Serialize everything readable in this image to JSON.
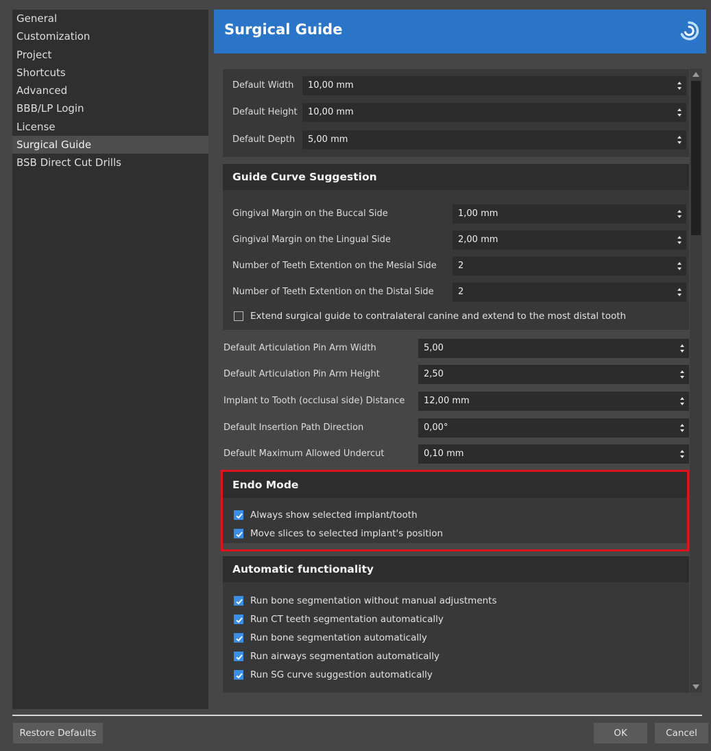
{
  "sidebar": {
    "items": [
      {
        "label": "General"
      },
      {
        "label": "Customization"
      },
      {
        "label": "Project"
      },
      {
        "label": "Shortcuts"
      },
      {
        "label": "Advanced"
      },
      {
        "label": "BBB/LP Login"
      },
      {
        "label": "License"
      },
      {
        "label": "Surgical Guide",
        "active": true
      },
      {
        "label": "BSB Direct Cut Drills"
      }
    ]
  },
  "header": {
    "title": "Surgical Guide",
    "logo_icon": "swirl-logo-icon"
  },
  "defaults": {
    "width": {
      "label": "Default Width",
      "value": "10,00 mm"
    },
    "height": {
      "label": "Default Height",
      "value": "10,00 mm"
    },
    "depth": {
      "label": "Default Depth",
      "value": "5,00 mm"
    }
  },
  "guide_curve": {
    "title": "Guide Curve Suggestion",
    "buccal": {
      "label": "Gingival Margin on the Buccal Side",
      "value": "1,00 mm"
    },
    "lingual": {
      "label": "Gingival Margin on the Lingual Side",
      "value": "2,00 mm"
    },
    "mesial": {
      "label": "Number of Teeth Extention on the Mesial Side",
      "value": "2"
    },
    "distal": {
      "label": "Number of Teeth Extention on the Distal Side",
      "value": "2"
    },
    "extend": {
      "label": "Extend surgical guide to contralateral canine and extend to the most distal tooth",
      "checked": false
    }
  },
  "articulation": {
    "pin_width": {
      "label": "Default Articulation Pin Arm Width",
      "value": "5,00"
    },
    "pin_height": {
      "label": "Default Articulation Pin Arm Height",
      "value": "2,50"
    },
    "implant_distance": {
      "label": "Implant to Tooth (occlusal side) Distance",
      "value": "12,00 mm"
    },
    "insertion_path": {
      "label": "Default Insertion Path Direction",
      "value": "0,00°"
    },
    "undercut": {
      "label": "Default Maximum Allowed Undercut",
      "value": "0,10 mm"
    }
  },
  "endo_mode": {
    "title": "Endo Mode",
    "show_selected": {
      "label": "Always show selected implant/tooth",
      "checked": true
    },
    "move_slices": {
      "label": "Move slices to selected implant's position",
      "checked": true
    }
  },
  "automatic": {
    "title": "Automatic functionality",
    "items": [
      {
        "label": "Run bone segmentation without manual adjustments",
        "checked": true
      },
      {
        "label": "Run CT teeth segmentation automatically",
        "checked": true
      },
      {
        "label": "Run bone segmentation automatically",
        "checked": true
      },
      {
        "label": "Run airways segmentation automatically",
        "checked": true
      },
      {
        "label": "Run SG curve suggestion automatically",
        "checked": true
      }
    ]
  },
  "footer": {
    "restore_label": "Restore Defaults",
    "ok_label": "OK",
    "cancel_label": "Cancel"
  },
  "colors": {
    "header_blue": "#2a75c8",
    "checkbox_blue": "#3a8ee6",
    "highlight_red": "#e0121c"
  }
}
